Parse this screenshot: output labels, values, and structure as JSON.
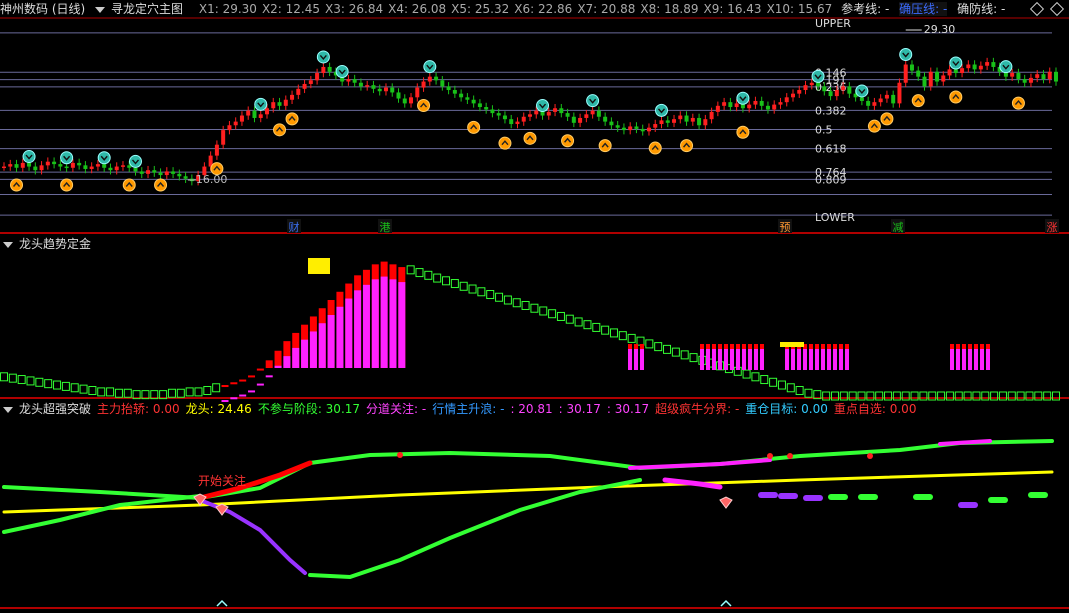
{
  "header": {
    "stock": "神州数码 (日线)",
    "indicator": "寻龙定穴主图",
    "values": [
      "X1: 29.30",
      "X2: 12.45",
      "X3: 26.84",
      "X4: 26.08",
      "X5: 25.32",
      "X6: 22.86",
      "X7: 20.88",
      "X8: 18.89",
      "X9: 16.43",
      "X10: 15.67"
    ],
    "ref_label": "参考线: -",
    "blue_label": "确压线: -",
    "defense_label": "确防线: -"
  },
  "colors": {
    "up": "#ff2020",
    "down": "#19c119",
    "magenta": "#ff22ff",
    "yellow": "#ffff00",
    "green_line": "#33ff33",
    "purple": "#9933ff",
    "grid": "#6a6a9a",
    "border": "#b00000"
  },
  "panel1": {
    "labels": {
      "upper": "UPPER",
      "lower": "LOWER",
      "fib": [
        "0.146",
        "0.191",
        "0.236",
        "0.382",
        "0.5",
        "0.618",
        "0.764",
        "0.809"
      ],
      "high": "29.30",
      "low": "16.00"
    },
    "events": [
      "财",
      "港",
      "预",
      "减",
      "涨"
    ]
  },
  "panel2": {
    "title": "龙头趋势定金"
  },
  "panel3": {
    "title": "龙头超强突破",
    "items": [
      {
        "label": "主力抬轿:",
        "value": "0.00",
        "color": "#ff3333"
      },
      {
        "label": "龙头:",
        "value": "24.46",
        "color": "#ffff00"
      },
      {
        "label": "不参与阶段:",
        "value": "30.17",
        "color": "#33ff33"
      },
      {
        "label": "分道关注:",
        "value": "-",
        "color": "#ff44ff"
      },
      {
        "label": "行情主升浪:",
        "value": "-",
        "color": "#3399ff"
      },
      {
        "label": "",
        "value": ": 20.81",
        "color": "#ff44ff"
      },
      {
        "label": "",
        "value": ": 30.17",
        "color": "#ff44ff"
      },
      {
        "label": "",
        "value": ": 30.17",
        "color": "#ff44ff"
      },
      {
        "label": "超级疯牛分界:",
        "value": "-",
        "color": "#ff3333"
      },
      {
        "label": "重仓目标:",
        "value": "0.00",
        "color": "#33ccff"
      },
      {
        "label": "重点自选:",
        "value": "0.00",
        "color": "#ff3333"
      }
    ],
    "annotation": "开始关注"
  },
  "chart_data": [
    {
      "type": "candlestick",
      "title": "寻龙定穴主图",
      "ylim": [
        15.2,
        31.5
      ],
      "levels": [
        {
          "name": "0.146",
          "value": 27.36
        },
        {
          "name": "0.191",
          "value": 26.76
        },
        {
          "name": "0.236",
          "value": 26.16
        },
        {
          "name": "0.382",
          "value": 24.22
        },
        {
          "name": "0.5",
          "value": 22.65
        },
        {
          "name": "0.618",
          "value": 21.08
        },
        {
          "name": "0.764",
          "value": 19.14
        },
        {
          "name": "0.809",
          "value": 18.54
        }
      ],
      "high": 29.3,
      "low": 16.0,
      "close": [
        19.6,
        19.8,
        19.5,
        19.9,
        19.6,
        19.3,
        19.7,
        20.0,
        19.8,
        19.6,
        19.5,
        19.9,
        19.7,
        19.4,
        19.6,
        19.8,
        19.5,
        19.3,
        19.6,
        19.7,
        19.5,
        19.2,
        19.0,
        19.3,
        19.1,
        18.9,
        19.2,
        19.0,
        18.8,
        18.6,
        18.4,
        18.9,
        19.6,
        20.5,
        21.4,
        22.6,
        23.0,
        23.3,
        23.8,
        24.2,
        23.6,
        23.9,
        24.4,
        24.9,
        24.6,
        25.1,
        25.5,
        26.0,
        26.4,
        26.7,
        27.3,
        27.8,
        27.4,
        27.1,
        26.6,
        26.8,
        26.5,
        26.2,
        26.3,
        26.0,
        25.8,
        26.1,
        25.7,
        25.2,
        24.8,
        25.3,
        26.1,
        26.6,
        27.0,
        26.7,
        26.2,
        25.9,
        25.6,
        25.3,
        25.1,
        24.8,
        24.5,
        24.3,
        24.0,
        23.8,
        23.5,
        23.1,
        23.3,
        23.7,
        23.9,
        24.2,
        23.8,
        24.1,
        24.4,
        24.0,
        23.7,
        23.2,
        23.6,
        23.9,
        24.2,
        23.7,
        23.3,
        23.0,
        22.8,
        22.6,
        22.9,
        22.7,
        22.5,
        22.8,
        23.1,
        23.4,
        23.2,
        23.5,
        23.8,
        23.3,
        23.6,
        23.0,
        23.5,
        24.1,
        24.6,
        24.9,
        24.5,
        24.8,
        24.4,
        24.7,
        25.0,
        24.6,
        24.3,
        24.7,
        24.9,
        25.3,
        25.6,
        25.9,
        26.3,
        26.5,
        26.2,
        25.8,
        25.4,
        25.9,
        26.2,
        25.6,
        25.3,
        25.0,
        24.6,
        24.9,
        25.2,
        25.5,
        24.8,
        26.5,
        28.0,
        27.5,
        27.0,
        26.2,
        27.4,
        26.6,
        27.1,
        27.6,
        27.3,
        27.7,
        28.0,
        27.6,
        27.9,
        28.2,
        27.8,
        27.4,
        27.0,
        27.3,
        26.8,
        26.5,
        26.9,
        27.2,
        26.8,
        27.4,
        26.6
      ],
      "markers_up": [
        3,
        11,
        25,
        33,
        50,
        61,
        73,
        85,
        93,
        111,
        118,
        131,
        150,
        158,
        168,
        185,
        201,
        214,
        225,
        236,
        259,
        279,
        292,
        317,
        366,
        399,
        424
      ],
      "markers_down": [
        7,
        18,
        29,
        38,
        54,
        67,
        86,
        108,
        134,
        148,
        165,
        179,
        201,
        215,
        237,
        273,
        303,
        330,
        353,
        378,
        399,
        423
      ]
    },
    {
      "type": "bar",
      "title": "龙头趋势定金",
      "ylim": [
        0,
        105
      ],
      "pink": [
        0,
        0,
        0,
        0,
        0,
        0,
        0,
        0,
        0,
        0,
        0,
        0,
        0,
        0,
        0,
        0,
        0,
        0,
        0,
        0,
        0,
        0,
        0,
        0,
        0,
        0,
        0,
        0,
        0,
        0,
        0,
        0,
        0,
        0,
        0,
        0,
        0,
        0,
        0,
        0,
        0,
        0,
        0,
        0,
        0,
        0,
        0,
        0,
        0,
        0,
        0,
        0,
        0,
        0,
        0,
        0,
        0,
        0,
        0,
        0,
        0,
        0,
        0,
        0,
        0,
        0,
        0,
        0,
        0,
        0,
        0,
        0,
        0,
        0,
        0,
        0,
        0,
        0,
        0,
        0,
        0,
        0,
        0,
        0,
        0,
        0,
        0,
        0,
        0,
        0,
        0,
        0,
        0,
        0,
        0,
        0,
        0,
        0,
        0,
        0,
        0,
        0,
        0,
        0,
        0,
        0,
        0,
        0,
        0,
        0,
        0,
        0,
        0,
        0,
        0,
        0,
        0,
        0,
        0,
        0,
        0,
        0,
        0,
        0,
        0,
        0,
        0,
        0,
        0,
        0,
        0,
        0,
        0,
        0,
        0,
        0,
        0,
        0,
        0,
        0,
        0,
        0,
        0,
        0,
        0,
        0,
        0,
        0,
        0,
        0,
        0,
        0,
        0,
        0,
        0,
        0,
        0,
        0,
        0,
        0,
        0,
        0,
        0,
        0,
        0,
        0,
        0,
        0,
        0,
        0,
        0,
        0,
        0,
        0,
        0,
        0,
        0,
        0,
        0,
        0,
        0,
        0,
        0,
        0,
        0,
        0,
        0,
        0,
        0,
        0,
        0,
        0
      ],
      "series": [
        {
          "name": "",
          "values": [
            14,
            13,
            12,
            11,
            10,
            9,
            8,
            7,
            6,
            5,
            4,
            3,
            3,
            2,
            2,
            1,
            1,
            1,
            1,
            2,
            2,
            3,
            3,
            4,
            6,
            8,
            10,
            12,
            15,
            20,
            26,
            33,
            40,
            46,
            52,
            58,
            64,
            70,
            76,
            82,
            88,
            92,
            96,
            98,
            96,
            94,
            92,
            90,
            88,
            86,
            84,
            82,
            80,
            78,
            76,
            74,
            72,
            70,
            68,
            66,
            64,
            62,
            60,
            58,
            56,
            54,
            52,
            50,
            48,
            46,
            44,
            42,
            40,
            38,
            36,
            34,
            32,
            30,
            28,
            26,
            24,
            22,
            20,
            18,
            16,
            14,
            12,
            10,
            8,
            6,
            4,
            2,
            1,
            0,
            0,
            0,
            0,
            0,
            0,
            0,
            0,
            0,
            0,
            0,
            0,
            0,
            0,
            0,
            0,
            0,
            0,
            0,
            0,
            0,
            0,
            0,
            0,
            0,
            0,
            0
          ]
        }
      ]
    }
  ]
}
